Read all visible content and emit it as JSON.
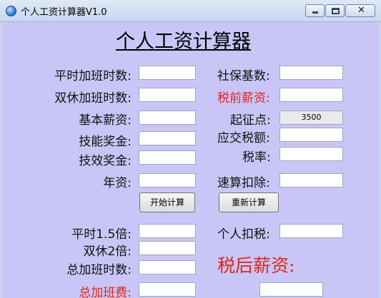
{
  "window": {
    "title": "个人工资计算器V1.0",
    "controls": {
      "minimize": "minimize",
      "maximize": "maximize",
      "close": "✕"
    }
  },
  "heading": "个人工资计算器",
  "left_fields": [
    {
      "label": "平时加班时数:",
      "value": ""
    },
    {
      "label": "双休加班时数:",
      "value": ""
    },
    {
      "label": "基本薪资:",
      "value": ""
    },
    {
      "label": "技能奖金:",
      "value": ""
    },
    {
      "label": "技效奖金:",
      "value": ""
    },
    {
      "label": "年资:",
      "value": ""
    }
  ],
  "right_fields": [
    {
      "label": "社保基数:",
      "value": ""
    },
    {
      "label": "税前薪资:",
      "value": ""
    },
    {
      "label": "起征点:",
      "value": "3500"
    },
    {
      "label": "应交税额:",
      "value": ""
    },
    {
      "label": "税率:",
      "value": ""
    },
    {
      "label": "速算扣除:",
      "value": ""
    }
  ],
  "buttons": {
    "calculate": "开始计算",
    "recalculate": "重新计算"
  },
  "results_left": [
    {
      "label": "平时1.5倍:",
      "value": ""
    },
    {
      "label": "双休2倍:",
      "value": ""
    },
    {
      "label": "总加班时数:",
      "value": ""
    },
    {
      "label": "总加班费:",
      "value": ""
    }
  ],
  "results_right": {
    "personal_tax_label": "个人扣税:",
    "personal_tax_value": "",
    "net_salary_label": "税后薪资:",
    "net_salary_value": ""
  },
  "colors": {
    "client_bg": "#c9c6f7",
    "accent_red": "#e0241a"
  }
}
